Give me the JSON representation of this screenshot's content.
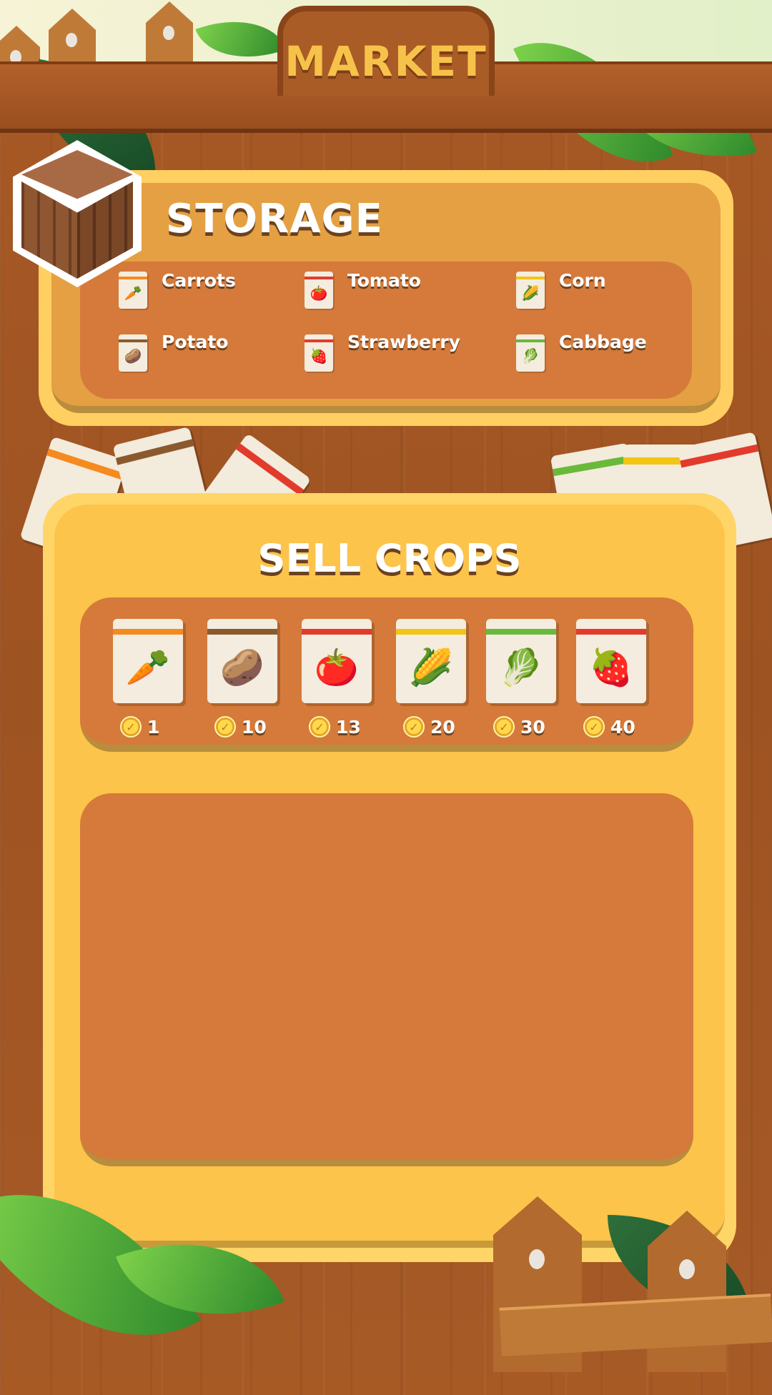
{
  "market": {
    "title": "MARKET"
  },
  "storage": {
    "title": "STORAGE",
    "items": [
      {
        "label": "Carrots",
        "icon": "carrot-icon",
        "glyph": "🥕",
        "stripe": "#f58a1f"
      },
      {
        "label": "Tomato",
        "icon": "tomato-icon",
        "glyph": "🍅",
        "stripe": "#e23b2c"
      },
      {
        "label": "Corn",
        "icon": "corn-icon",
        "glyph": "🌽",
        "stripe": "#f3c514"
      },
      {
        "label": "Potato",
        "icon": "potato-icon",
        "glyph": "🥔",
        "stripe": "#8a5a2e"
      },
      {
        "label": "Strawberry",
        "icon": "strawberry-icon",
        "glyph": "🍓",
        "stripe": "#e23b2c"
      },
      {
        "label": "Cabbage",
        "icon": "cabbage-icon",
        "glyph": "🥬",
        "stripe": "#6ab93a"
      }
    ]
  },
  "sell": {
    "title": "SELL CROPS",
    "crops": [
      {
        "icon": "carrot-seed-pack",
        "glyph": "🥕",
        "stripe": "#f58a1f",
        "price": "1"
      },
      {
        "icon": "potato-seed-pack",
        "glyph": "🥔",
        "stripe": "#8a5a2e",
        "price": "10"
      },
      {
        "icon": "tomato-seed-pack",
        "glyph": "🍅",
        "stripe": "#e23b2c",
        "price": "13"
      },
      {
        "icon": "corn-seed-pack",
        "glyph": "🌽",
        "stripe": "#f3c514",
        "price": "20"
      },
      {
        "icon": "cabbage-seed-pack",
        "glyph": "🥬",
        "stripe": "#6ab93a",
        "price": "30"
      },
      {
        "icon": "strawberry-seed-pack",
        "glyph": "🍓",
        "stripe": "#e23b2c",
        "price": "40"
      }
    ],
    "coin_glyph": "✓"
  }
}
